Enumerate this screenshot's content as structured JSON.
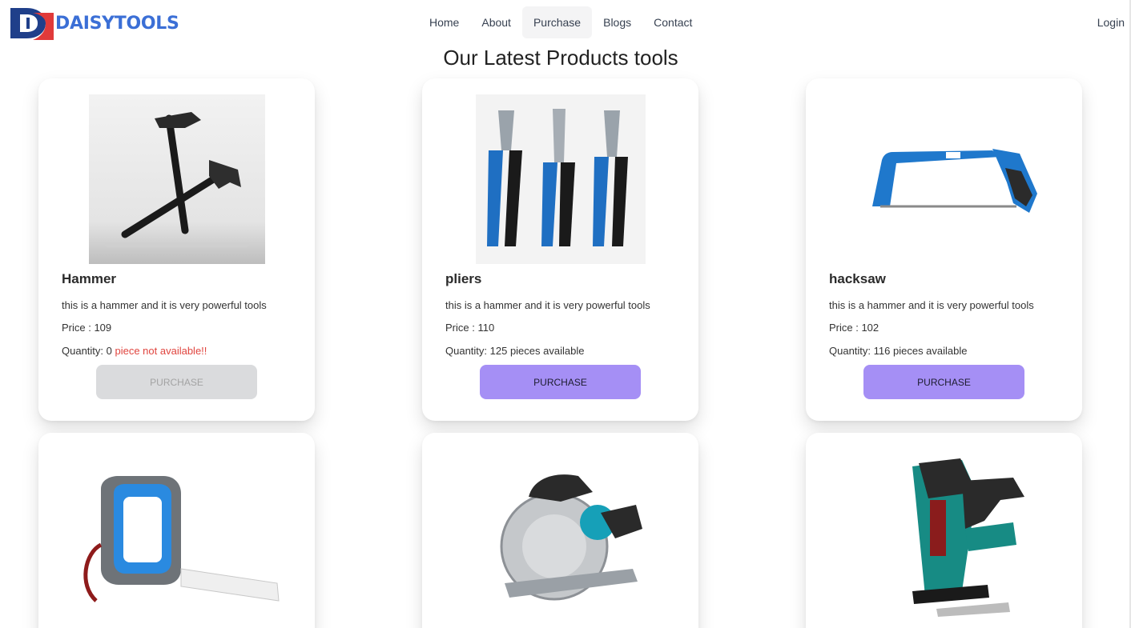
{
  "brand": {
    "name": "DAISYTOOLS",
    "accent_color": "#3b6fd6"
  },
  "nav": {
    "items": [
      {
        "label": "Home"
      },
      {
        "label": "About"
      },
      {
        "label": "Purchase"
      },
      {
        "label": "Blogs"
      },
      {
        "label": "Contact"
      }
    ],
    "active": "Purchase",
    "login_label": "Login"
  },
  "section_title": "Our Latest Products tools",
  "products": [
    {
      "name": "Hammer",
      "description": "this is a hammer and it is very powerful tools",
      "price_text": "Price : 109",
      "quantity_text": "Quantity: 0",
      "availability_text": " piece not available!!",
      "button_label": "PURCHASE",
      "icon": "hammer-image"
    },
    {
      "name": "pliers",
      "description": "this is a hammer and it is very powerful tools",
      "price_text": "Price : 110",
      "quantity_text": "Quantity: 125",
      "availability_text": " pieces available",
      "button_label": "PURCHASE",
      "icon": "pliers-image"
    },
    {
      "name": "hacksaw",
      "description": "this is a hammer and it is very powerful tools",
      "price_text": "Price : 102",
      "quantity_text": "Quantity: 116",
      "availability_text": " pieces available",
      "button_label": "PURCHASE",
      "icon": "hacksaw-image"
    },
    {
      "icon": "tape-measure-image"
    },
    {
      "icon": "circular-saw-image"
    },
    {
      "icon": "staple-gun-image"
    }
  ],
  "colors": {
    "purchase_button": "#a58ff5",
    "purchase_button_disabled": "#dadbdd",
    "unavailable_text": "#e0453f"
  }
}
